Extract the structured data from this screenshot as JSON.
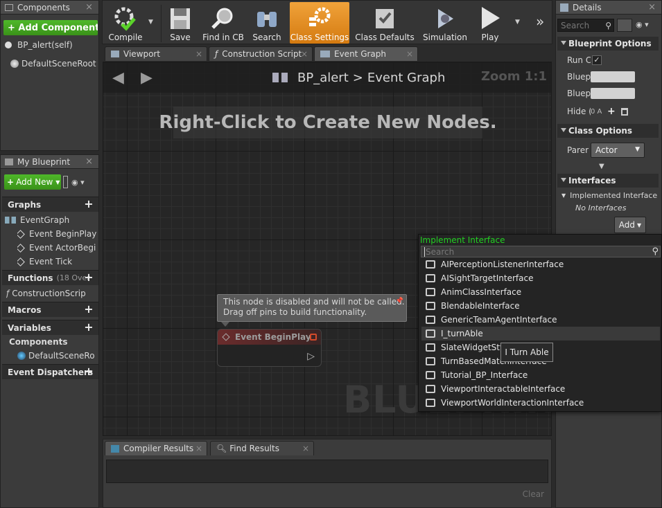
{
  "components_panel": {
    "title": "Components",
    "add_button": "+ Add Component",
    "items": [
      "BP_alert(self)",
      "DefaultSceneRoot"
    ]
  },
  "my_blueprint_panel": {
    "title": "My Blueprint",
    "add_button": "Add New",
    "sections": {
      "graphs": "Graphs",
      "functions": "Functions",
      "functions_note": "(18 Over",
      "macros": "Macros",
      "variables": "Variables",
      "components": "Components",
      "event_dispatchers": "Event Dispatchers"
    },
    "graph_items": [
      "EventGraph",
      "Event BeginPlay",
      "Event ActorBegi",
      "Event Tick"
    ],
    "function_items": [
      "ConstructionScrip"
    ],
    "component_items": [
      "DefaultSceneRo"
    ]
  },
  "toolbar": {
    "buttons": [
      "Compile",
      "Save",
      "Find in CB",
      "Search",
      "Class Settings",
      "Class Defaults",
      "Simulation",
      "Play"
    ]
  },
  "doc_tabs": [
    "Viewport",
    "Construction Script",
    "Event Graph"
  ],
  "graph": {
    "breadcrumb_root": "BP_alert",
    "breadcrumb_sep": ">",
    "breadcrumb_current": "Event Graph",
    "zoom": "Zoom 1:1",
    "hint": "Right-Click to Create New Nodes.",
    "watermark": "BLUEPRINT",
    "tooltip_line1": "This node is disabled and will not be called.",
    "tooltip_line2": "Drag off pins to build functionality.",
    "node_title": "Event BeginPlay"
  },
  "bottom_tabs": [
    "Compiler Results",
    "Find Results"
  ],
  "bottom": {
    "clear_label": "Clear"
  },
  "details_panel": {
    "title": "Details",
    "search_placeholder": "Search",
    "blueprint_options": "Blueprint Options",
    "run_label": "Run C",
    "bluep1": "Bluep",
    "bluep2": "Bluep",
    "hide_label": "Hide (",
    "hide_value": "0 A",
    "class_options": "Class Options",
    "parent_label": "Parer",
    "parent_value": "Actor",
    "interfaces": "Interfaces",
    "implemented_label": "Implemented Interface",
    "no_interfaces": "No Interfaces",
    "add_button": "Add"
  },
  "implement_menu": {
    "title": "Implement Interface",
    "search_placeholder": "Search",
    "items": [
      "AIPerceptionListenerInterface",
      "AISightTargetInterface",
      "AnimClassInterface",
      "BlendableInterface",
      "GenericTeamAgentInterface",
      "I_turnAble",
      "SlateWidgetStyleInterface",
      "TurnBasedMatchInterface",
      "Tutorial_BP_Interface",
      "ViewportInteractableInterface",
      "ViewportWorldInteractionInterface"
    ],
    "hover_tooltip": "I Turn Able"
  },
  "colors": {
    "accent_orange": "#e08a1e",
    "green": "#3e9a1e",
    "menu_title": "#22d022"
  }
}
